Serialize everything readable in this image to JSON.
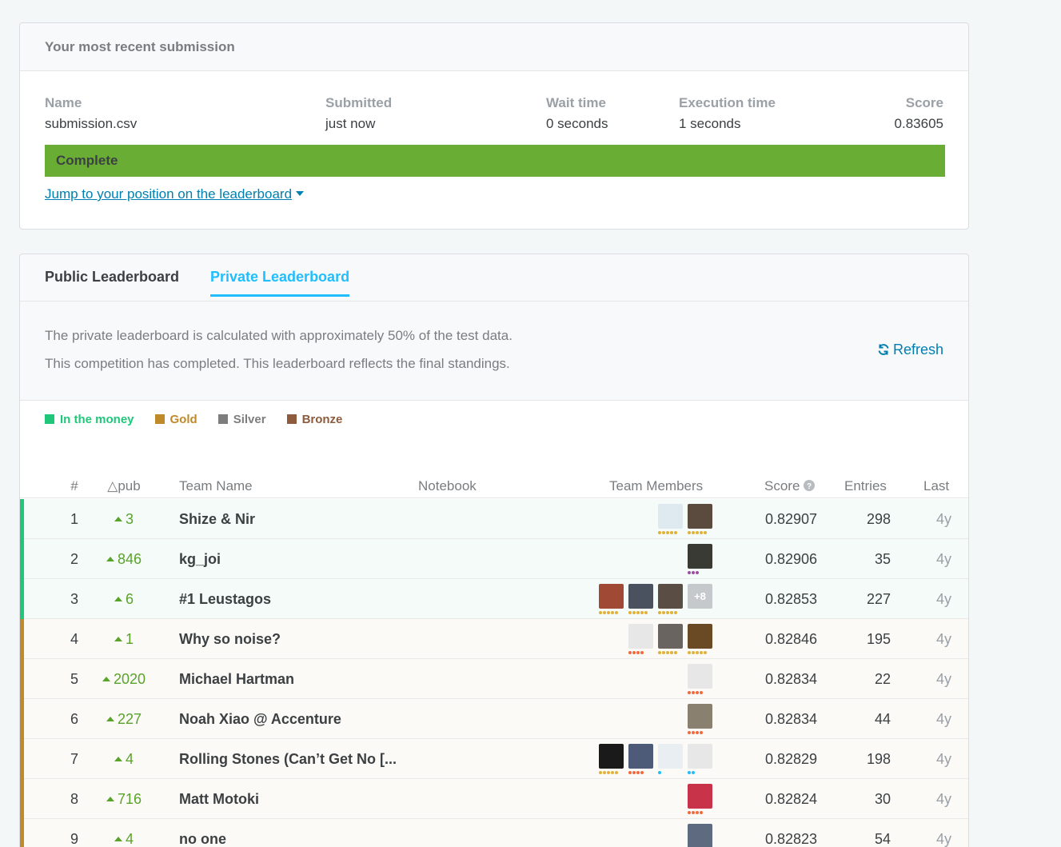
{
  "submission": {
    "header": "Your most recent submission",
    "name_label": "Name",
    "name_value": "submission.csv",
    "submitted_label": "Submitted",
    "submitted_value": "just now",
    "wait_label": "Wait time",
    "wait_value": "0 seconds",
    "exec_label": "Execution time",
    "exec_value": "1 seconds",
    "score_label": "Score",
    "score_value": "0.83605",
    "status": "Complete",
    "progress": 1.0,
    "jump_link": "Jump to your position on the leaderboard"
  },
  "tabs": {
    "public": "Public Leaderboard",
    "private": "Private Leaderboard"
  },
  "info": {
    "line1": "The private leaderboard is calculated with approximately 50% of the test data.",
    "line2": "This competition has completed. This leaderboard reflects the final standings.",
    "refresh": "Refresh"
  },
  "legend": [
    {
      "label": "In the money",
      "color": "#20c77b"
    },
    {
      "label": "Gold",
      "color": "#c08a2b"
    },
    {
      "label": "Silver",
      "color": "#7d7d7d"
    },
    {
      "label": "Bronze",
      "color": "#8e5b3d"
    }
  ],
  "columns": {
    "rank": "#",
    "delta": "△pub",
    "team": "Team Name",
    "notebook": "Notebook",
    "members": "Team Members",
    "score": "Score",
    "entries": "Entries",
    "last": "Last"
  },
  "rows": [
    {
      "rank": "1",
      "delta": "3",
      "team": "Shize & Nir",
      "score": "0.82907",
      "entries": "298",
      "last": "4y",
      "tier": "money",
      "members": [
        {
          "color": "#dfe9f0",
          "dots": "gold",
          "n": 5
        },
        {
          "color": "#5b4a3e",
          "dots": "gold",
          "n": 5
        }
      ]
    },
    {
      "rank": "2",
      "delta": "846",
      "team": "kg_joi",
      "score": "0.82906",
      "entries": "35",
      "last": "4y",
      "tier": "money",
      "members": [
        {
          "color": "#3a3a34",
          "dots": "purple",
          "n": 3
        }
      ]
    },
    {
      "rank": "3",
      "delta": "6",
      "team": "#1 Leustagos",
      "score": "0.82853",
      "entries": "227",
      "last": "4y",
      "tier": "money",
      "members": [
        {
          "color": "#a04a36",
          "dots": "gold",
          "n": 5
        },
        {
          "color": "#4a5260",
          "dots": "gold",
          "n": 5
        },
        {
          "color": "#5a4d44",
          "dots": "gold",
          "n": 5
        },
        {
          "plus": "+8"
        }
      ]
    },
    {
      "rank": "4",
      "delta": "1",
      "team": "Why so noise?",
      "score": "0.82846",
      "entries": "195",
      "last": "4y",
      "tier": "gold",
      "members": [
        {
          "color": "#e7e7e7",
          "dots": "red",
          "n": 4
        },
        {
          "color": "#6a6460",
          "dots": "gold",
          "n": 5
        },
        {
          "color": "#6a4a24",
          "dots": "gold",
          "n": 5
        }
      ]
    },
    {
      "rank": "5",
      "delta": "2020",
      "team": "Michael Hartman",
      "score": "0.82834",
      "entries": "22",
      "last": "4y",
      "tier": "gold",
      "members": [
        {
          "color": "#e7e7e7",
          "dots": "red",
          "n": 4
        }
      ]
    },
    {
      "rank": "6",
      "delta": "227",
      "team": "Noah Xiao @ Accenture",
      "score": "0.82834",
      "entries": "44",
      "last": "4y",
      "tier": "gold",
      "members": [
        {
          "color": "#8a8070",
          "dots": "red",
          "n": 4
        }
      ]
    },
    {
      "rank": "7",
      "delta": "4",
      "team": "Rolling Stones (Can’t Get No [...",
      "score": "0.82829",
      "entries": "198",
      "last": "4y",
      "tier": "gold",
      "members": [
        {
          "color": "#1a1a1a",
          "dots": "gold",
          "n": 5
        },
        {
          "color": "#4d5a78",
          "dots": "red",
          "n": 4
        },
        {
          "color": "#e8eef2",
          "dots": "teal",
          "n": 1
        },
        {
          "color": "#e7e7e7",
          "dots": "teal",
          "n": 2
        }
      ]
    },
    {
      "rank": "8",
      "delta": "716",
      "team": "Matt Motoki",
      "score": "0.82824",
      "entries": "30",
      "last": "4y",
      "tier": "gold",
      "members": [
        {
          "color": "#c8334a",
          "dots": "red",
          "n": 4
        }
      ]
    },
    {
      "rank": "9",
      "delta": "4",
      "team": "no one",
      "score": "0.82823",
      "entries": "54",
      "last": "4y",
      "tier": "gold",
      "members": [
        {
          "color": "#5d6a80",
          "dots": "red",
          "n": 4
        }
      ]
    }
  ],
  "colors": {
    "money_bar": "#20c77b",
    "gold_bar": "#c08a2b",
    "money_row": "#f4fbf8",
    "gold_row": "#fbfaf7",
    "dot_gold": "#e1b23a",
    "dot_red": "#f06a3e",
    "dot_purple": "#9b4ea0",
    "dot_teal": "#20beff"
  }
}
